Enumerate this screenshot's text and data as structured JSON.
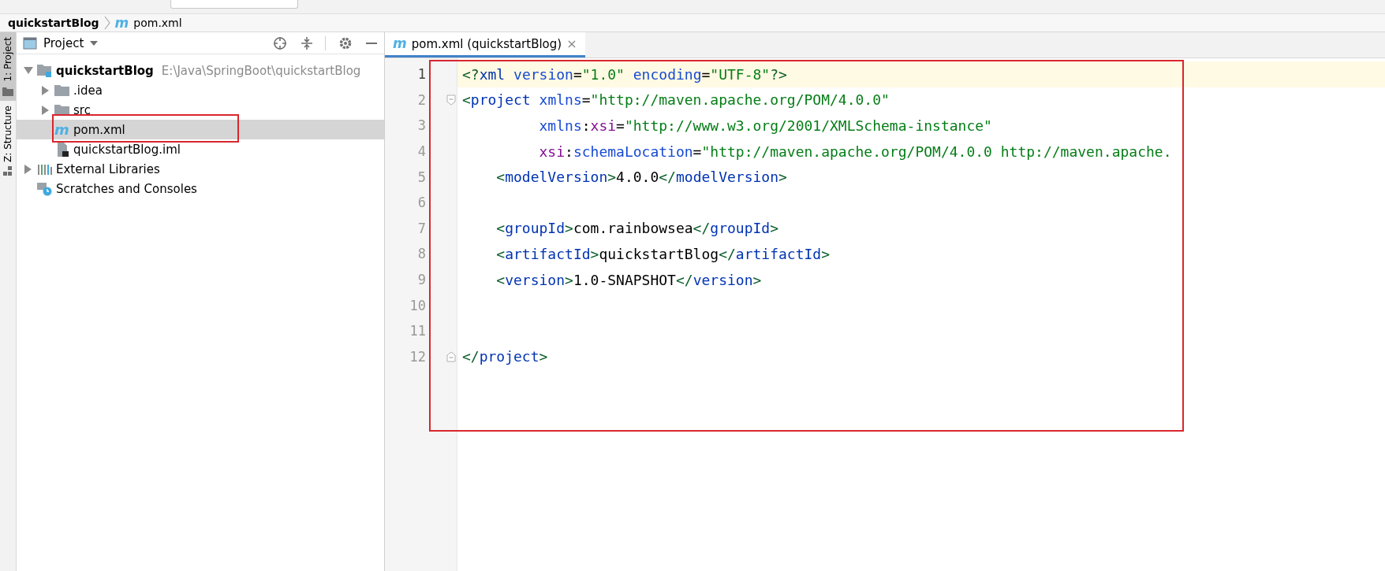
{
  "breadcrumb": {
    "project": "quickstartBlog",
    "file_icon": "m",
    "file": "pom.xml"
  },
  "side_tabs": [
    {
      "label": "1: Project",
      "selected": true,
      "kind": "folder"
    },
    {
      "label": "Z: Structure",
      "selected": false,
      "kind": "structure"
    }
  ],
  "project_panel": {
    "title": "Project",
    "tree": [
      {
        "label": "quickstartBlog",
        "hint": "E:\\Java\\SpringBoot\\quickstartBlog",
        "kind": "module",
        "expanded": true,
        "selected": false,
        "children": [
          {
            "label": ".idea",
            "kind": "folder",
            "expanded": false,
            "selected": false
          },
          {
            "label": "src",
            "kind": "folder",
            "expanded": false,
            "selected": false
          },
          {
            "label": "pom.xml",
            "kind": "maven",
            "icon": "m",
            "selected": true
          },
          {
            "label": "quickstartBlog.iml",
            "kind": "iml",
            "selected": false
          }
        ]
      },
      {
        "label": "External Libraries",
        "kind": "libraries",
        "expanded": false,
        "selected": false
      },
      {
        "label": "Scratches and Consoles",
        "kind": "scratches",
        "selected": false
      }
    ]
  },
  "editor": {
    "tab": {
      "icon": "m",
      "label": "pom.xml (quickstartBlog)",
      "close": "×",
      "selected": true
    },
    "lines": [
      {
        "number": "1",
        "current": true,
        "kind": "plain",
        "tokens": [
          {
            "text": "<?",
            "kind": "punct"
          },
          {
            "text": "xml ",
            "kind": "tag"
          },
          {
            "text": "version",
            "kind": "attr"
          },
          {
            "text": "=",
            "kind": "plain"
          },
          {
            "text": "\"1.0\" ",
            "kind": "value"
          },
          {
            "text": "encoding",
            "kind": "attr"
          },
          {
            "text": "=",
            "kind": "plain"
          },
          {
            "text": "\"UTF-8\"",
            "kind": "value"
          },
          {
            "text": "?>",
            "kind": "punct"
          }
        ]
      },
      {
        "number": "2",
        "current": false,
        "kind": "fold-start",
        "tokens": [
          {
            "text": "<",
            "kind": "punct"
          },
          {
            "text": "project ",
            "kind": "tag"
          },
          {
            "text": "xmlns",
            "kind": "attr"
          },
          {
            "text": "=",
            "kind": "plain"
          },
          {
            "text": "\"http://maven.apache.org/POM/4.0.0\"",
            "kind": "value"
          }
        ]
      },
      {
        "number": "3",
        "current": false,
        "kind": "plain",
        "tokens": [
          {
            "text": "         xmlns",
            "kind": "attr"
          },
          {
            "text": ":",
            "kind": "plain"
          },
          {
            "text": "xsi",
            "kind": "namespace"
          },
          {
            "text": "=",
            "kind": "plain"
          },
          {
            "text": "\"http://www.w3.org/2001/XMLSchema-instance\"",
            "kind": "value"
          }
        ]
      },
      {
        "number": "4",
        "current": false,
        "kind": "plain",
        "tokens": [
          {
            "text": "         xsi",
            "kind": "namespace"
          },
          {
            "text": ":",
            "kind": "plain"
          },
          {
            "text": "schemaLocation",
            "kind": "attr"
          },
          {
            "text": "=",
            "kind": "plain"
          },
          {
            "text": "\"http://maven.apache.org/POM/4.0.0 http://maven.apache.",
            "kind": "value"
          }
        ]
      },
      {
        "number": "5",
        "current": false,
        "kind": "plain",
        "tokens": [
          {
            "text": "    <",
            "kind": "punct"
          },
          {
            "text": "modelVersion",
            "kind": "tag"
          },
          {
            "text": ">",
            "kind": "punct"
          },
          {
            "text": "4.0.0",
            "kind": "plain"
          },
          {
            "text": "</",
            "kind": "punct"
          },
          {
            "text": "modelVersion",
            "kind": "tag"
          },
          {
            "text": ">",
            "kind": "punct"
          }
        ]
      },
      {
        "number": "6",
        "current": false,
        "kind": "plain"
      },
      {
        "number": "7",
        "current": false,
        "kind": "plain",
        "tokens": [
          {
            "text": "    <",
            "kind": "punct"
          },
          {
            "text": "groupId",
            "kind": "tag"
          },
          {
            "text": ">",
            "kind": "punct"
          },
          {
            "text": "com.rainbowsea",
            "kind": "plain"
          },
          {
            "text": "</",
            "kind": "punct"
          },
          {
            "text": "groupId",
            "kind": "tag"
          },
          {
            "text": ">",
            "kind": "punct"
          }
        ]
      },
      {
        "number": "8",
        "current": false,
        "kind": "plain",
        "tokens": [
          {
            "text": "    <",
            "kind": "punct"
          },
          {
            "text": "artifactId",
            "kind": "tag"
          },
          {
            "text": ">",
            "kind": "punct"
          },
          {
            "text": "quickstartBlog",
            "kind": "plain"
          },
          {
            "text": "</",
            "kind": "punct"
          },
          {
            "text": "artifactId",
            "kind": "tag"
          },
          {
            "text": ">",
            "kind": "punct"
          }
        ]
      },
      {
        "number": "9",
        "current": false,
        "kind": "plain",
        "tokens": [
          {
            "text": "    <",
            "kind": "punct"
          },
          {
            "text": "version",
            "kind": "tag"
          },
          {
            "text": ">",
            "kind": "punct"
          },
          {
            "text": "1.0-SNAPSHOT",
            "kind": "plain"
          },
          {
            "text": "</",
            "kind": "punct"
          },
          {
            "text": "version",
            "kind": "tag"
          },
          {
            "text": ">",
            "kind": "punct"
          }
        ]
      },
      {
        "number": "10",
        "current": false,
        "kind": "plain"
      },
      {
        "number": "11",
        "current": false,
        "kind": "plain"
      },
      {
        "number": "12",
        "current": false,
        "kind": "fold-end",
        "tokens": [
          {
            "text": "</",
            "kind": "punct"
          },
          {
            "text": "project",
            "kind": "tag"
          },
          {
            "text": ">",
            "kind": "punct"
          }
        ]
      }
    ]
  }
}
